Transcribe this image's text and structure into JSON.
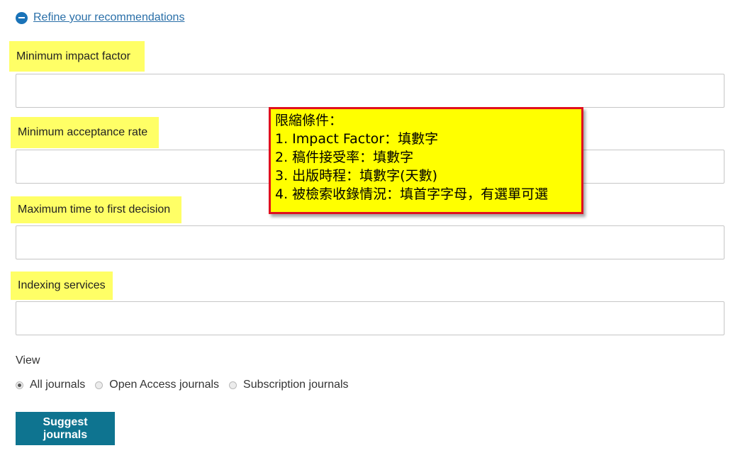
{
  "refine": {
    "label": "Refine your recommendations",
    "icon": "minus-circle-icon"
  },
  "fields": [
    {
      "label": "Minimum impact factor",
      "value": "",
      "placeholder": ""
    },
    {
      "label": "Minimum acceptance rate",
      "value": "",
      "placeholder": ""
    },
    {
      "label": "Maximum time to first decision",
      "value": "",
      "placeholder": ""
    },
    {
      "label": "Indexing services",
      "value": "",
      "placeholder": ""
    }
  ],
  "callout": {
    "lines": [
      "限縮條件：",
      "1. Impact Factor：填數字",
      "2. 稿件接受率：填數字",
      "3. 出版時程：填數字(天數)",
      "4. 被檢索收錄情況：填首字字母，有選單可選"
    ]
  },
  "view": {
    "label": "View",
    "options": [
      "All journals",
      "Open Access journals",
      "Subscription journals"
    ],
    "selected": "All journals"
  },
  "submit_label": "Suggest journals",
  "colors": {
    "highlight": "#ffff66",
    "callout_bg": "#ffff00",
    "callout_border": "#e0101e",
    "button": "#0e7490",
    "link": "#2a6fa8"
  }
}
